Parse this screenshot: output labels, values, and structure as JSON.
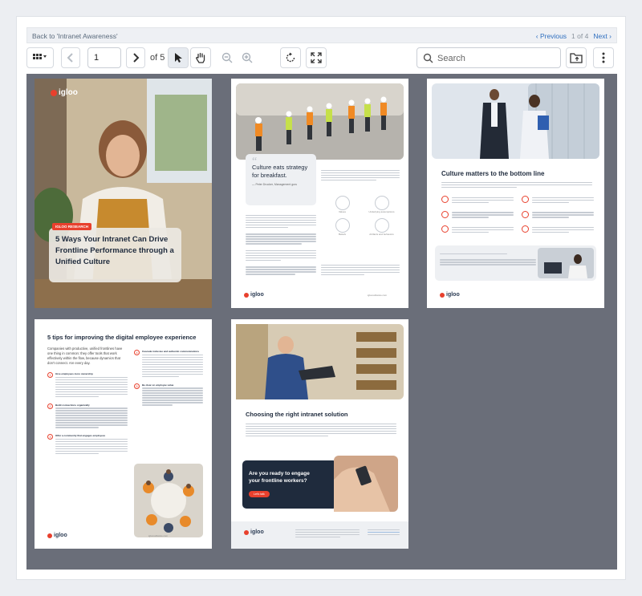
{
  "nav": {
    "back_label": "Back to 'Intranet Awareness'",
    "previous_label": "‹ Previous",
    "count_label": "1 of 4",
    "next_label": "Next ›"
  },
  "toolbar": {
    "page_value": "1",
    "of_pages": "of 5",
    "search_placeholder": "Search"
  },
  "pages": {
    "p1": {
      "logo": "igloo",
      "tag": "IGLOO RESEARCH",
      "title": "5 Ways Your Intranet Can Drive Frontline Performance through a Unified Culture"
    },
    "p2": {
      "quote": "Culture eats strategy for breakfast.",
      "author": "— Peter Drucker, Management guru",
      "icons": [
        "Values",
        "Underlying assumptions",
        "Beliefs",
        "Artifacts and behaviors"
      ],
      "footer_logo": "igloo",
      "footer_url": "igloosoftware.com"
    },
    "p3": {
      "heading": "Culture matters to the bottom line",
      "footer_logo": "igloo"
    },
    "p4": {
      "heading": "5 tips for improving the digital employee experience",
      "intro": "Companies with productive, unified frontlines have one thing in common: they offer tools that work effectively within the flow, because dynamics that don't connect. Are every day.",
      "tips": [
        "Give employees more ownership",
        "Build connections organically",
        "Offer a community that engages employees",
        "Cascade inclusive and authentic communications",
        "Be clear on employee value"
      ],
      "footer_logo": "igloo",
      "footer_url": "igloosoftware.com"
    },
    "p5": {
      "heading": "Choosing the right intranet solution",
      "cta": "Are you ready to engage your frontline workers?",
      "cta_button": "Let's talk",
      "footer_logo": "igloo"
    }
  },
  "colors": {
    "accent": "#e8402d",
    "navy": "#1f2b3d",
    "link": "#2f6fbf",
    "canvas": "#6a6e79"
  }
}
